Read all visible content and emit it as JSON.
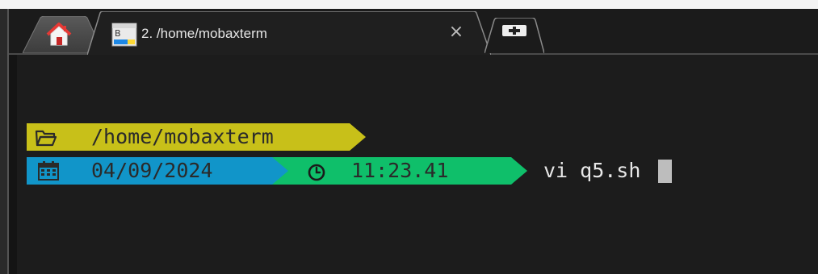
{
  "tabs": {
    "home": {
      "icon": "home-icon"
    },
    "active": {
      "icon": "terminal-session-icon",
      "label": "2. /home/mobaxterm",
      "close_glyph": "×"
    },
    "new_tab": {
      "icon": "plus-icon"
    }
  },
  "prompt": {
    "path": {
      "icon": "folder-icon",
      "text": "/home/mobaxterm",
      "color": "#c8c019"
    },
    "date": {
      "icon": "calendar-icon",
      "text": "04/09/2024",
      "color": "#1195c9"
    },
    "time": {
      "icon": "clock-icon",
      "text": "11:23.41",
      "color": "#0fbf6a"
    },
    "command": "vi q5.sh"
  },
  "colors": {
    "background": "#1c1c1c",
    "text_dark": "#2a2a2a",
    "text_light": "#e8e8e8"
  }
}
